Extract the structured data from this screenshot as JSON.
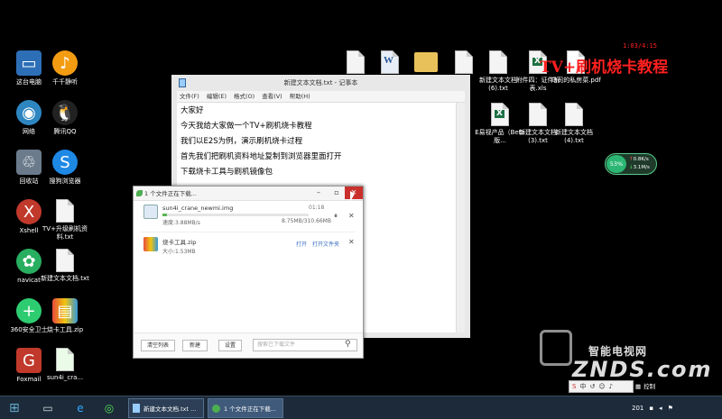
{
  "desktop_icons": [
    {
      "label": "这台电脑",
      "icon": "computer-icon"
    },
    {
      "label": "千千静听",
      "icon": "ttplayer-icon"
    },
    {
      "label": "网络",
      "icon": "network-icon"
    },
    {
      "label": "腾讯QQ",
      "icon": "qq-icon"
    },
    {
      "label": "回收站",
      "icon": "recycle-bin-icon"
    },
    {
      "label": "搜狗浏览器",
      "icon": "sogou-browser-icon"
    },
    {
      "label": "Xshell",
      "icon": "xshell-icon"
    },
    {
      "label": "TV+升级刷机资料.txt",
      "icon": "text-file-icon"
    },
    {
      "label": "navicat",
      "icon": "navicat-icon"
    },
    {
      "label": "新建文本文档.txt",
      "icon": "text-file-icon"
    },
    {
      "label": "360安全卫士",
      "icon": "360-icon"
    },
    {
      "label": "烧卡工具.zip",
      "icon": "zip-icon"
    },
    {
      "label": "Foxmail",
      "icon": "foxmail-icon"
    },
    {
      "label": "sun4i_cra...",
      "icon": "img-file-icon"
    },
    {
      "label": "",
      "icon": "text-file-icon"
    },
    {
      "label": "",
      "icon": "word-file-icon"
    },
    {
      "label": "",
      "icon": "folder-icon"
    },
    {
      "label": "",
      "icon": "text-file-icon"
    },
    {
      "label": "新建文本文档 (6).txt",
      "icon": "text-file-icon"
    },
    {
      "label": "附件四：证件附表.xls",
      "icon": "excel-file-icon"
    },
    {
      "label": "乌司的私房菜.pdf",
      "icon": "pdf-file-icon"
    },
    {
      "label": "E易视产品（Beta版...",
      "icon": "excel-file-icon"
    },
    {
      "label": "新建文本文档 (3).txt",
      "icon": "text-file-icon"
    },
    {
      "label": "新建文本文档 (4).txt",
      "icon": "text-file-icon"
    }
  ],
  "overlay": {
    "time": "1:03/4:15",
    "title": "TV+刷机烧卡教程",
    "title_color": "#ff2020"
  },
  "net_widget": {
    "percent": "53%",
    "up": "0.8K/s",
    "down": "3.1M/s"
  },
  "notepad": {
    "title": "新建文本文档.txt - 记事本",
    "menu": [
      "文件(F)",
      "编辑(E)",
      "格式(O)",
      "查看(V)",
      "帮助(H)"
    ],
    "lines": [
      "大家好",
      "今天我给大家做一个TV+刷机烧卡教程",
      "我们以E2S为例，演示刷机烧卡过程",
      "首先我们把刷机资料地址复制到浏览器里面打开",
      "下载烧卡工具与刷机镜像包"
    ]
  },
  "download": {
    "title": "1 个文件正在下载...",
    "items": [
      {
        "name": "sun4i_crane_newmi.img",
        "time": "01:18",
        "speed": "速度:3.88MB/s",
        "size": "8.75MB/310.66MB",
        "progress": 0.028
      },
      {
        "name": "烧卡工具.zip",
        "size": "大小:1.53MB",
        "open": "打开",
        "open_folder": "打开文件夹"
      }
    ],
    "footer": {
      "clear": "清空列表",
      "new": "新建",
      "settings": "设置",
      "search_placeholder": "搜索已下载文件"
    }
  },
  "watermark": {
    "top": "智能电视网",
    "bottom": "ZNDS.com"
  },
  "taskbar": {
    "tasks": [
      {
        "label": "新建文本文档.txt ..."
      },
      {
        "label": "1 个文件正在下载..."
      }
    ],
    "tray_label": "控制",
    "clock": "201"
  }
}
